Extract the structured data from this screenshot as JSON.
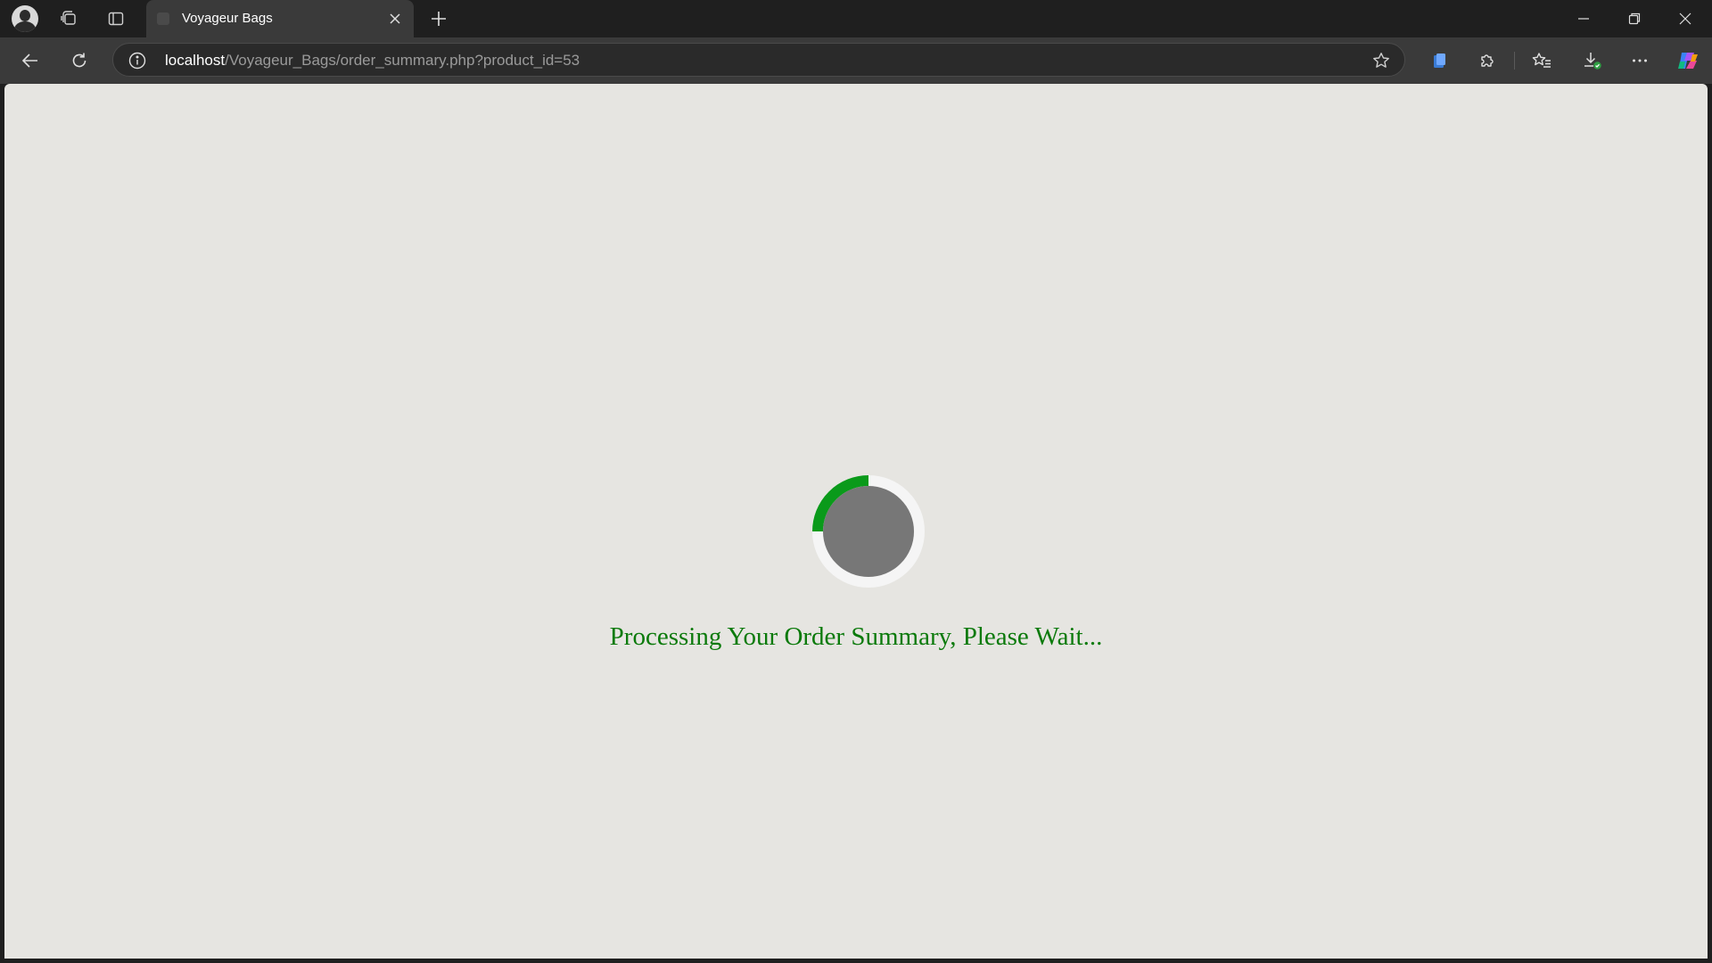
{
  "browser": {
    "tab": {
      "title": "Voyageur Bags"
    },
    "address_bar": {
      "url_host": "localhost",
      "url_path": "/Voyageur_Bags/order_summary.php?product_id=53"
    },
    "icons": {
      "profile": "profile-avatar-icon",
      "workspaces": "workspaces-icon",
      "tab_actions": "vertical-tabs-icon",
      "new_tab": "plus-icon",
      "back": "back-arrow-icon",
      "refresh": "refresh-icon",
      "site_info": "info-icon",
      "favorite": "star-icon",
      "collections": "collections-icon",
      "extensions": "puzzle-icon",
      "favorites": "favorites-list-icon",
      "downloads": "download-icon",
      "more": "more-dots-icon",
      "copilot": "copilot-icon"
    }
  },
  "page": {
    "status_text": "Processing Your Order Summary, Please Wait...",
    "colors": {
      "background": "#e6e5e1",
      "spinner_accent": "#0a9a1a",
      "spinner_center": "#777777",
      "spinner_track": "#f5f5f5",
      "text": "#0b7a0b"
    },
    "spinner_progress_fraction": 0.25
  }
}
